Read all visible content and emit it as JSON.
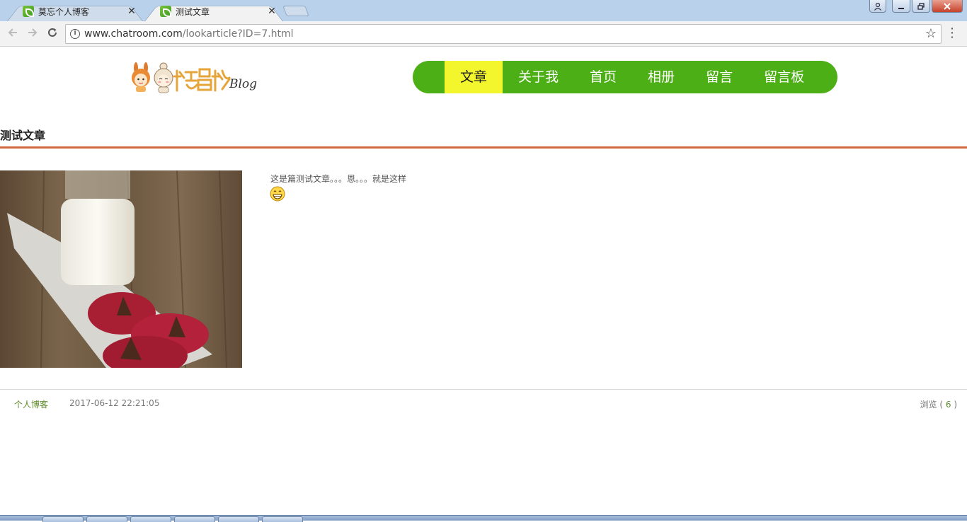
{
  "browser": {
    "tabs": [
      {
        "title": "莫忘个人博客",
        "active": false
      },
      {
        "title": "测试文章",
        "active": true
      }
    ],
    "tab_close_glyph": "✕",
    "address": {
      "host": "www.chatroom.com",
      "path": "/lookarticle?ID=7.html"
    }
  },
  "site": {
    "logo_alt": "杨昌权 Blog",
    "nav": [
      {
        "label": "文章",
        "active": true
      },
      {
        "label": "关于我",
        "active": false
      },
      {
        "label": "首页",
        "active": false
      },
      {
        "label": "相册",
        "active": false
      },
      {
        "label": "留言",
        "active": false
      },
      {
        "label": "留言板",
        "active": false
      }
    ]
  },
  "article": {
    "title": "测试文章",
    "body": "这是篇测试文章。。。恩。。。就是这样",
    "category": "个人博客",
    "datetime": "2017-06-12 22:21:05",
    "views_label": "浏览 (",
    "views": "6",
    "views_close": ")"
  },
  "colors": {
    "nav_bg": "#4caf16",
    "nav_active": "#f3f62c",
    "title_rule": "#d0693f",
    "link_green": "#5e8a2a"
  },
  "icons": [
    "site-favicon",
    "close-icon",
    "back-icon",
    "forward-icon",
    "reload-icon",
    "info-icon",
    "bookmark-star-icon",
    "menu-dots-icon",
    "grinning-emoji-icon"
  ]
}
